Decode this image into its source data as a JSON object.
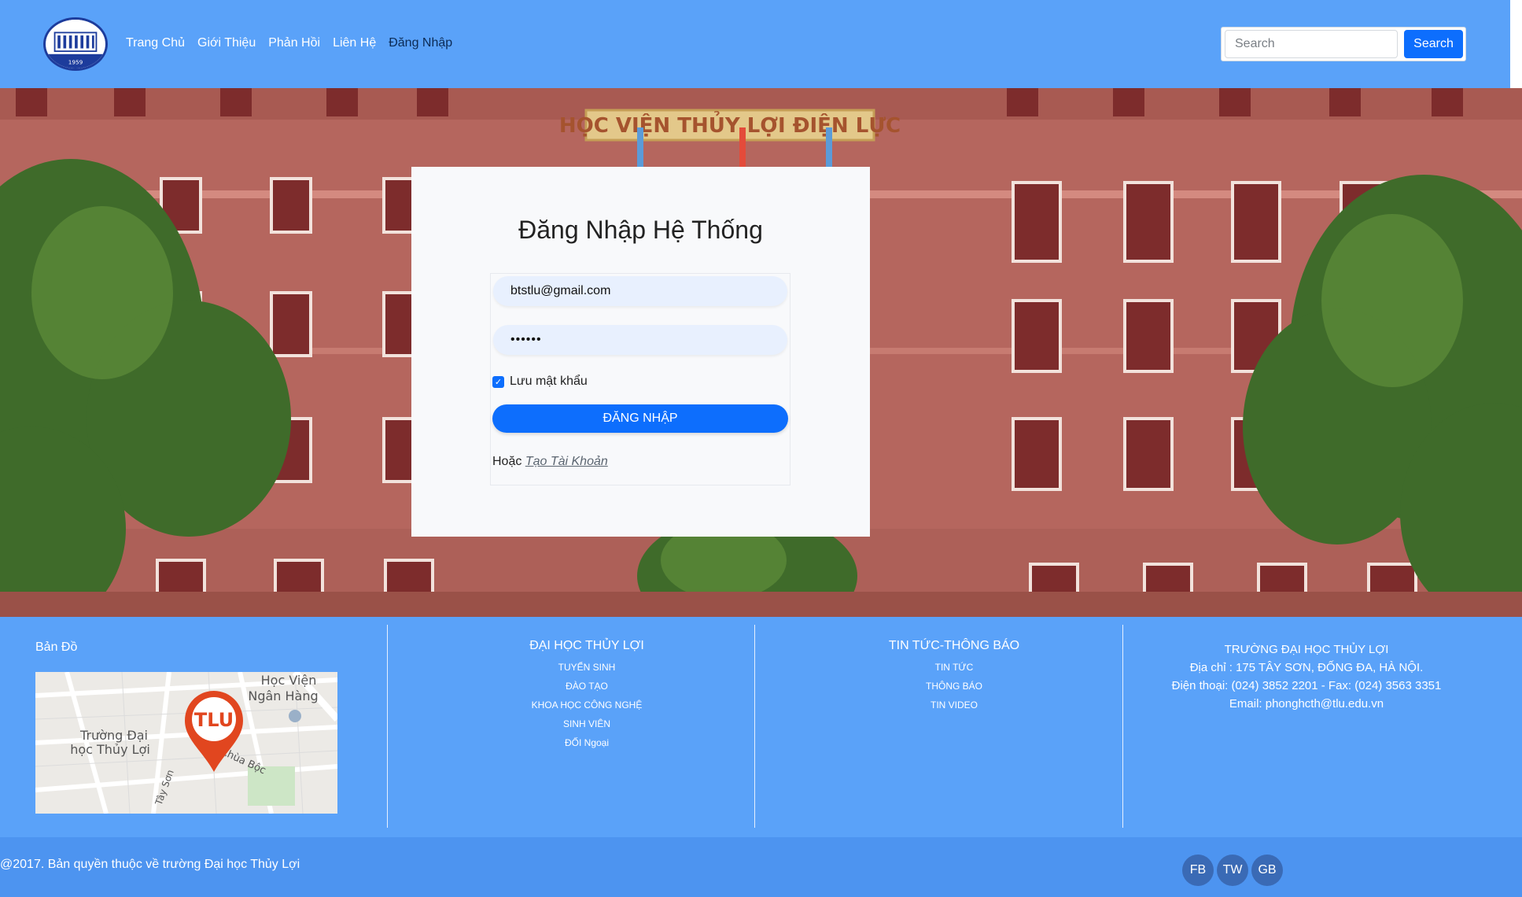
{
  "header": {
    "nav": [
      "Trang Chủ",
      "Giới Thiệu",
      "Phản Hồi",
      "Liên Hệ",
      "Đăng Nhập"
    ],
    "active_nav": "Đăng Nhập",
    "search": {
      "placeholder": "Search",
      "button": "Search"
    },
    "logo_year": "1959"
  },
  "hero": {
    "building_sign": "HỌC VIỆN THỦY LỢI ĐIỆN LỰC"
  },
  "login": {
    "title": "Đăng Nhập Hệ Thống",
    "email_value": "btstlu@gmail.com",
    "password_value": "••••••",
    "remember_label": "Lưu mật khẩu",
    "remember_checked": true,
    "submit": "ĐĂNG NHẬP",
    "alt_prefix": "Hoặc",
    "alt_link": "Tạo Tài Khoản"
  },
  "footer": {
    "map": {
      "title": "Bản Đồ",
      "pin_label": "TLU",
      "place_bank": [
        "Học Viện",
        "Ngân Hàng"
      ],
      "place_school": [
        "Trường Đại",
        "học Thủy Lợi"
      ],
      "street_1": "Chùa Bộc",
      "street_2": "Tây Sơn"
    },
    "university": {
      "title": "ĐẠI HỌC THỦY LỢI",
      "items": [
        "TUYỂN SINH",
        "ĐÀO TẠO",
        "KHOA HỌC CÔNG NGHỆ",
        "SINH VIÊN",
        "ĐỐI Ngoại"
      ]
    },
    "news": {
      "title": "TIN TỨC-THÔNG BÁO",
      "items": [
        "TIN TỨC",
        "THÔNG BÁO",
        "TIN VIDEO"
      ]
    },
    "contact": {
      "name": "TRƯỜNG ĐẠI HỌC THỦY LỢI",
      "address": "Địa chỉ : 175 TÂY SƠN, ĐỐNG ĐA, HÀ NỘI.",
      "phone": "Điện thoại: (024) 3852 2201 - Fax: (024) 3563 3351",
      "email": "Email: phonghcth@tlu.edu.vn"
    },
    "copyright": "@2017. Bản quyền thuộc về trường Đại học Thủy Lợi",
    "social": [
      "FB",
      "TW",
      "GB"
    ]
  },
  "colors": {
    "header_bg": "#5aa2f9",
    "primary": "#0d6efd",
    "bottom_bar": "#4d94f0"
  }
}
